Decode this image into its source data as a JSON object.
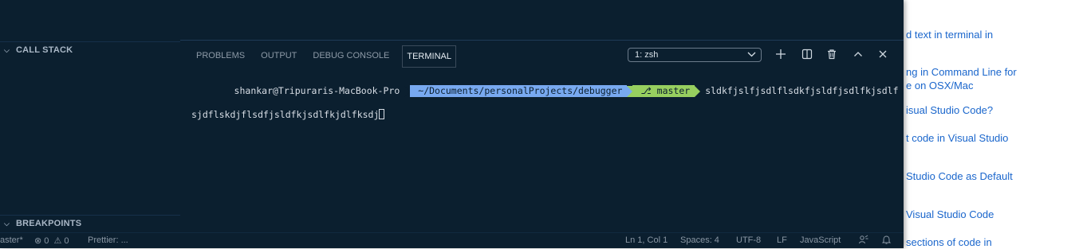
{
  "browser_links": [
    "d text in terminal in",
    "ng in Command Line for",
    "e on OSX/Mac",
    "isual Studio Code?",
    "t code in Visual Studio",
    "Studio Code as Default",
    "Visual Studio Code",
    "sections of code in"
  ],
  "sidebar": {
    "call_stack": "CALL STACK",
    "breakpoints": "BREAKPOINTS"
  },
  "panel": {
    "tabs": [
      "PROBLEMS",
      "OUTPUT",
      "DEBUG CONSOLE",
      "TERMINAL"
    ],
    "active_tab": "TERMINAL",
    "terminal_select": "1: zsh"
  },
  "terminal": {
    "user_host": "shankar@Tripuraris-MacBook-Pro",
    "path": "~/Documents/personalProjects/debugger",
    "branch_icon": "⎇",
    "branch": "master",
    "input_line1": "sldkfjslfjsdlflsdkfjsldfjsdlfkjsdlf",
    "input_line2": "sjdflskdjflsdfjsldfkjsdlfkjdlfksdj"
  },
  "status_bar": {
    "branch": "aster*",
    "errors": "0",
    "warnings": "0",
    "prettier": "Prettier: ...",
    "position": "Ln 1, Col 1",
    "spaces": "Spaces: 4",
    "encoding": "UTF-8",
    "eol": "LF",
    "language": "JavaScript"
  },
  "colors": {
    "background": "#0b1f2f",
    "path_segment": "#78a9f0",
    "branch_segment": "#97cf5f",
    "link": "#1a66cc"
  }
}
